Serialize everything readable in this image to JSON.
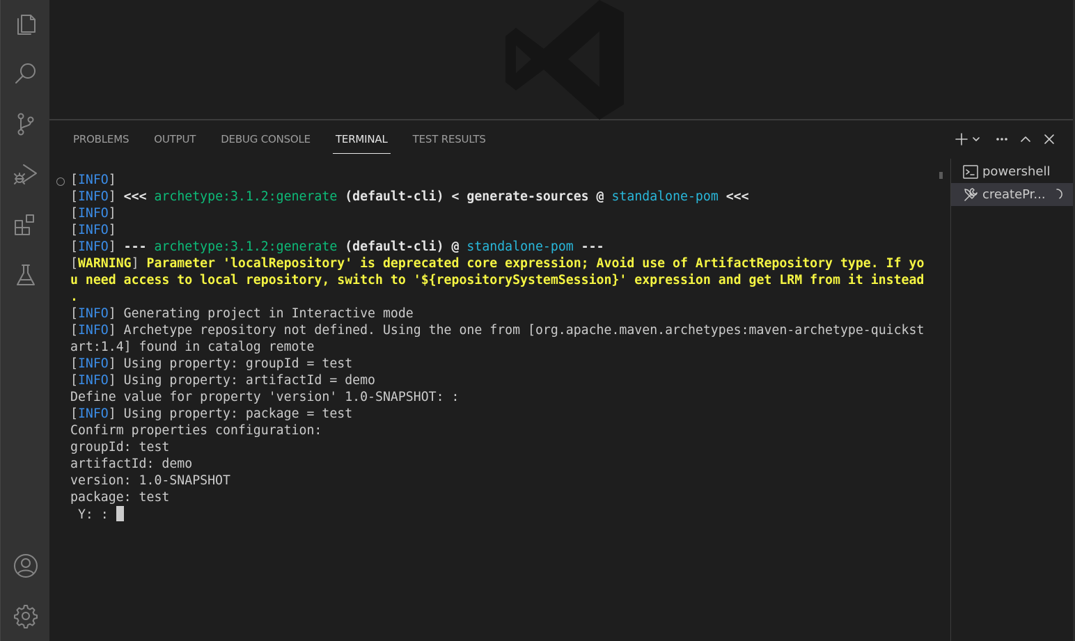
{
  "activity_bar": {
    "items": [
      {
        "name": "explorer-icon"
      },
      {
        "name": "search-icon"
      },
      {
        "name": "source-control-icon"
      },
      {
        "name": "run-debug-icon"
      },
      {
        "name": "extensions-icon"
      },
      {
        "name": "testing-icon"
      },
      {
        "name": "accounts-icon"
      },
      {
        "name": "settings-gear-icon"
      }
    ]
  },
  "panel": {
    "tabs": [
      {
        "label": "PROBLEMS",
        "active": false
      },
      {
        "label": "OUTPUT",
        "active": false
      },
      {
        "label": "DEBUG CONSOLE",
        "active": false
      },
      {
        "label": "TERMINAL",
        "active": true
      },
      {
        "label": "TEST RESULTS",
        "active": false
      }
    ],
    "actions": [
      "new-terminal-icon",
      "terminal-dropdown-icon",
      "more-actions-icon",
      "maximize-panel-icon",
      "close-panel-icon"
    ]
  },
  "terminal": {
    "lines": {
      "l1_tag": "INFO",
      "l2_tag": "INFO",
      "l2_a": " <<< ",
      "l2_goal": "archetype:3.1.2:generate",
      "l2_b": " (default-cli) < generate-sources @ ",
      "l2_proj": "standalone-pom",
      "l2_c": " <<<",
      "l3_tag": "INFO",
      "l4_tag": "INFO",
      "l5_tag": "INFO",
      "l5_a": " --- ",
      "l5_goal": "archetype:3.1.2:generate",
      "l5_b": " (default-cli) @ ",
      "l5_proj": "standalone-pom",
      "l5_c": " ---",
      "l6_tag": "WARNING",
      "l6_text": " Parameter 'localRepository' is deprecated core expression; Avoid use of ArtifactRepository type. If yo",
      "l7_text": "u need access to local repository, switch to '${repositorySystemSession}' expression and get LRM from it instead",
      "l8_text": ".",
      "l9_tag": "INFO",
      "l9_text": " Generating project in Interactive mode",
      "l10_tag": "INFO",
      "l10_text": " Archetype repository not defined. Using the one from [org.apache.maven.archetypes:maven-archetype-quickst",
      "l11_text": "art:1.4] found in catalog remote",
      "l12_tag": "INFO",
      "l12_text": " Using property: groupId = test",
      "l13_tag": "INFO",
      "l13_text": " Using property: artifactId = demo",
      "l14_text": "Define value for property 'version' 1.0-SNAPSHOT: :",
      "l15_tag": "INFO",
      "l15_text": " Using property: package = test",
      "l16_text": "Confirm properties configuration:",
      "l17_text": "groupId: test",
      "l18_text": "artifactId: demo",
      "l19_text": "version: 1.0-SNAPSHOT",
      "l20_text": "package: test",
      "l21_text": " Y: : "
    }
  },
  "terminal_list": {
    "items": [
      {
        "label": "powershell",
        "icon": "terminal-powershell-icon",
        "active": false
      },
      {
        "label": "createPr...",
        "icon": "tools-icon",
        "active": true,
        "loading": true
      }
    ]
  },
  "colors": {
    "info": "#3b8eea",
    "warning": "#f5f543",
    "goal": "#23d18b",
    "project": "#29b8db"
  }
}
